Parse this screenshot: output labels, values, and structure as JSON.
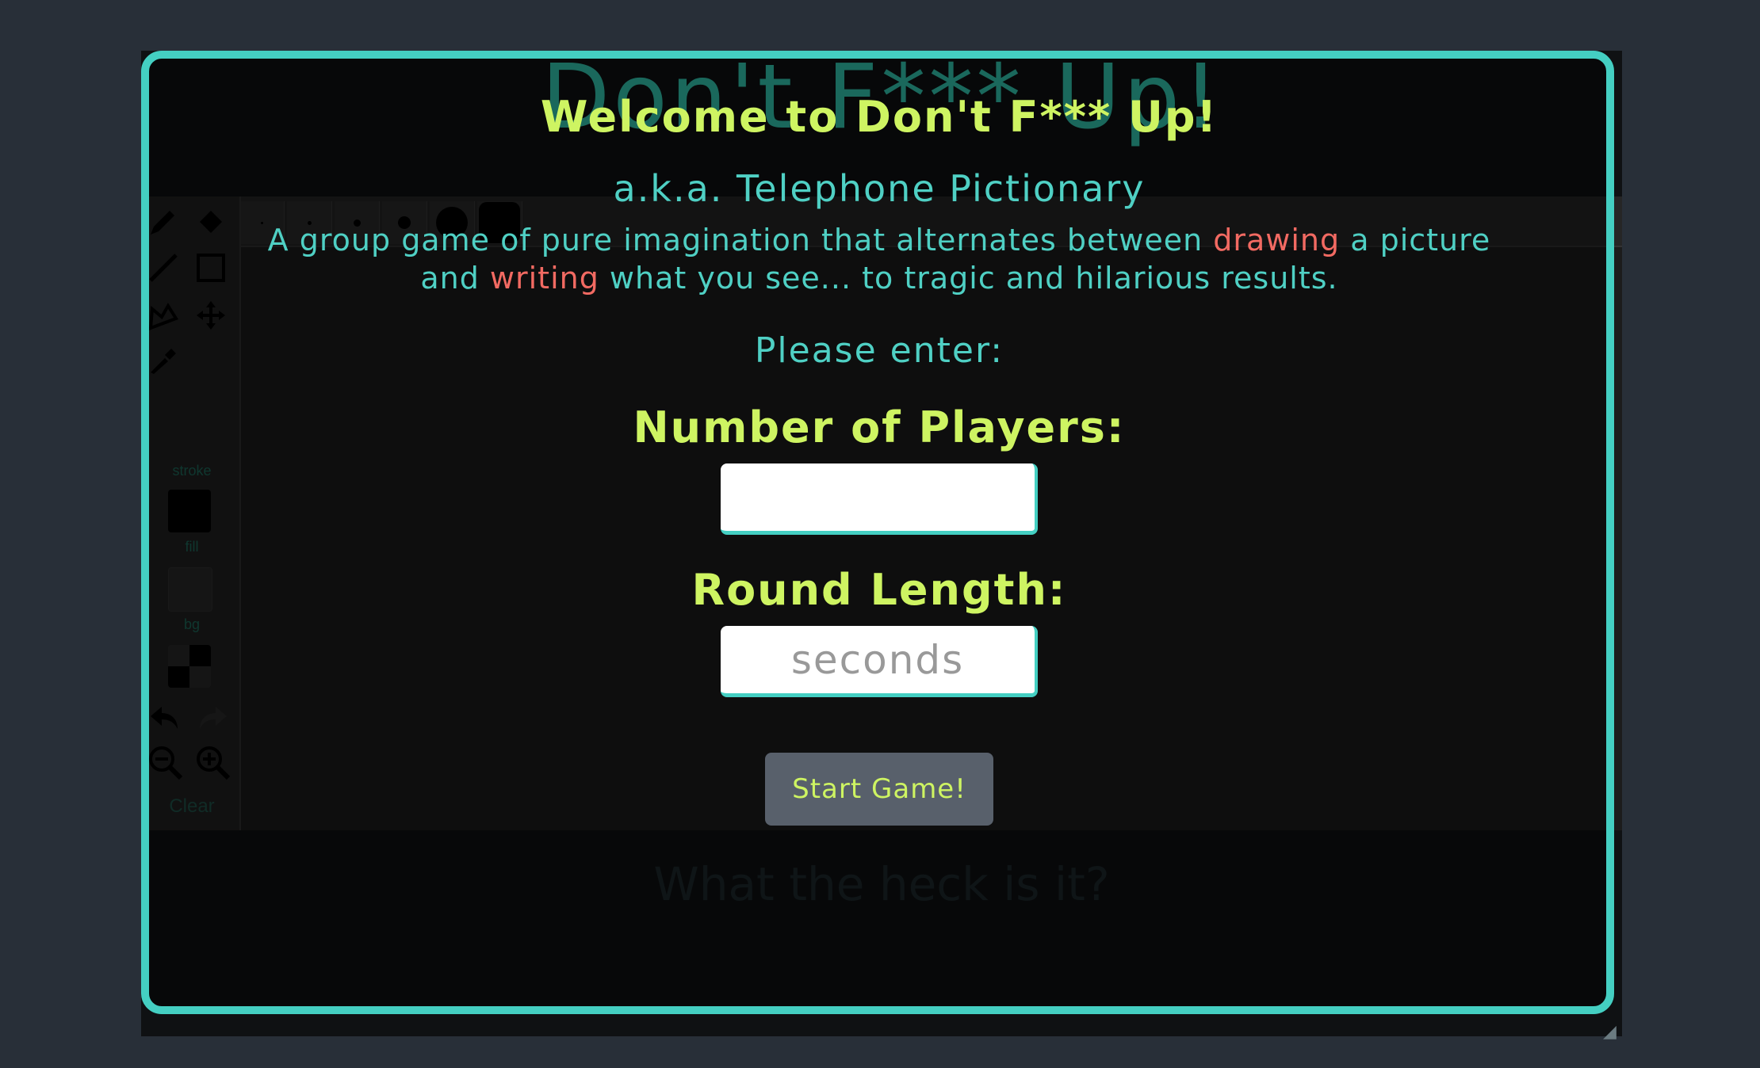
{
  "background": {
    "header_title": "Don't F*** Up!",
    "stroke_label": "stroke",
    "fill_label": "fill",
    "bg_label": "bg",
    "clear_label": "Clear",
    "prompt": "What the heck is it?"
  },
  "modal": {
    "title": "Welcome to Don't F*** Up!",
    "subtitle": "a.k.a. Telephone Pictionary",
    "desc_part1": "A group game of pure imagination that alternates between ",
    "desc_drawing": "drawing",
    "desc_part2": " a picture and ",
    "desc_writing": "writing",
    "desc_part3": " what you see... to tragic and hilarious results.",
    "please_enter": "Please enter:",
    "players_label": "Number of Players:",
    "players_value": "",
    "round_label": "Round Length:",
    "round_placeholder": "seconds",
    "start_button": "Start Game!"
  },
  "colors": {
    "accent_teal": "#44cfc2",
    "title_green": "#cef462",
    "highlight_red": "#f26a62",
    "button_gray": "#58606b"
  }
}
